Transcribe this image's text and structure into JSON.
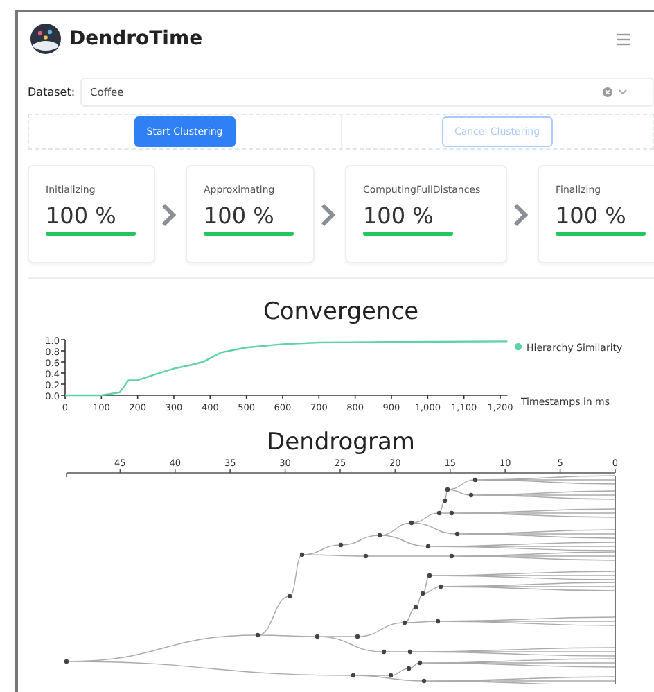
{
  "app": {
    "title": "DendroTime"
  },
  "dataset": {
    "label": "Dataset:",
    "value": "Coffee"
  },
  "buttons": [
    {
      "label": "Start Clustering",
      "kind": "primary",
      "disabled": false
    },
    {
      "label": "Cancel Clustering",
      "kind": "secondary",
      "disabled": true
    }
  ],
  "stages": [
    {
      "label": "Initializing",
      "value": "100 %"
    },
    {
      "label": "Approximating",
      "value": "100 %"
    },
    {
      "label": "ComputingFullDistances",
      "value": "100 %"
    },
    {
      "label": "Finalizing",
      "value": "100 %"
    }
  ],
  "convergence": {
    "chart_data": {
      "type": "line",
      "title": "Convergence",
      "xlabel": "Timestamps in ms",
      "x": [
        0,
        100,
        150,
        175,
        200,
        250,
        300,
        350,
        380,
        430,
        500,
        600,
        700,
        900,
        1220
      ],
      "series": [
        {
          "name": "Hierarchy Similarity",
          "color": "#5fd3a6",
          "values": [
            0,
            0,
            0.05,
            0.27,
            0.27,
            0.38,
            0.48,
            0.55,
            0.6,
            0.77,
            0.86,
            0.92,
            0.95,
            0.96,
            0.97
          ]
        }
      ],
      "xlim": [
        0,
        1220
      ],
      "ylim": [
        0,
        1
      ],
      "xticks": [
        0,
        100,
        200,
        300,
        400,
        500,
        600,
        700,
        800,
        900,
        {
          "value": 1000,
          "label": "1,000"
        },
        {
          "value": 1100,
          "label": "1,100"
        },
        {
          "value": 1200,
          "label": "1,200"
        }
      ],
      "yticks": [
        {
          "value": 0,
          "label": "0.0"
        },
        {
          "value": 0.2,
          "label": "0.2"
        },
        {
          "value": 0.4,
          "label": "0.4"
        },
        {
          "value": 0.6,
          "label": "0.6"
        },
        {
          "value": 0.8,
          "label": "0.8"
        },
        {
          "value": 1,
          "label": "1.0"
        }
      ]
    }
  },
  "dendrogram": {
    "title": "Dendrogram",
    "axis_ticks": [
      "45",
      "40",
      "35",
      "30",
      "25",
      "20",
      "15",
      "10",
      "5",
      "0"
    ]
  }
}
